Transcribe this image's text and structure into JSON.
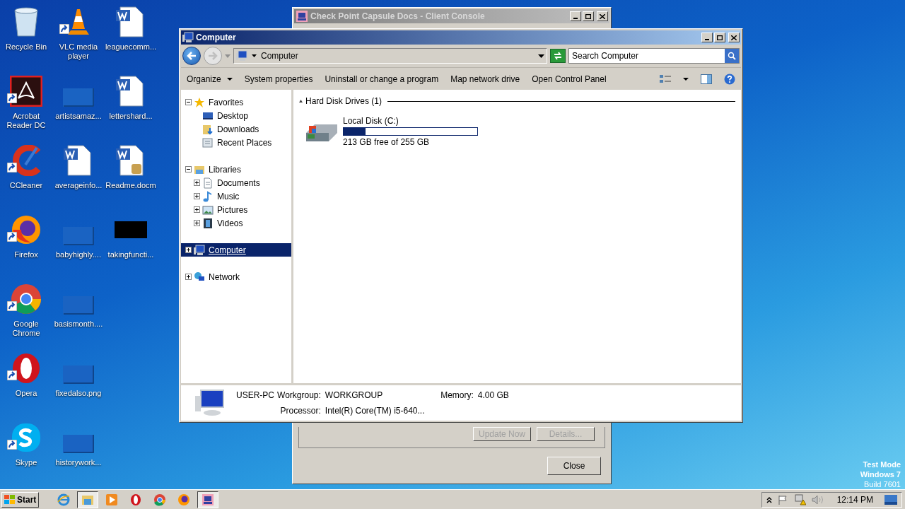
{
  "desktop_columns": [
    {
      "icons": [
        {
          "label": "Recycle Bin",
          "kind": "recycle"
        },
        {
          "label": "Acrobat Reader DC",
          "kind": "acrobat"
        },
        {
          "label": "CCleaner",
          "kind": "ccleaner"
        },
        {
          "label": "Firefox",
          "kind": "firefox"
        },
        {
          "label": "Google Chrome",
          "kind": "chrome"
        },
        {
          "label": "Opera",
          "kind": "opera"
        },
        {
          "label": "Skype",
          "kind": "skype"
        }
      ]
    },
    {
      "icons": [
        {
          "label": "VLC media player",
          "kind": "vlc"
        },
        {
          "label": "artistsamaz...",
          "kind": "blank"
        },
        {
          "label": "averageinfo...",
          "kind": "word"
        },
        {
          "label": "babyhighly....",
          "kind": "blank"
        },
        {
          "label": "basismonth....",
          "kind": "blank"
        },
        {
          "label": "fixedalso.png",
          "kind": "blank"
        },
        {
          "label": "historywork...",
          "kind": "blank"
        }
      ]
    },
    {
      "icons": [
        {
          "label": "leaguecomm...",
          "kind": "word"
        },
        {
          "label": "lettershard...",
          "kind": "word"
        },
        {
          "label": "Readme.docm",
          "kind": "word_macro"
        },
        {
          "label": "takingfuncti...",
          "kind": "black"
        }
      ]
    }
  ],
  "back_window": {
    "title": "Check Point Capsule Docs - Client Console",
    "buttons": [
      {
        "label": "Update Now",
        "disabled": true
      },
      {
        "label": "Details...",
        "disabled": true
      }
    ],
    "close_button": {
      "label": "Close",
      "disabled": false
    }
  },
  "window": {
    "title": "Computer",
    "address": "Computer",
    "search": {
      "placeholder": "Search Computer"
    },
    "commands": [
      {
        "label": "Organize",
        "dropdown": true
      },
      {
        "label": "System properties",
        "dropdown": false
      },
      {
        "label": "Uninstall or change a program",
        "dropdown": false
      },
      {
        "label": "Map network drive",
        "dropdown": false
      },
      {
        "label": "Open Control Panel",
        "dropdown": false
      }
    ],
    "nav": [
      {
        "label": "Favorites",
        "kind": "star",
        "expanded": true,
        "selected": false,
        "children": [
          {
            "label": "Desktop",
            "kind": "desktop",
            "selected": false
          },
          {
            "label": "Downloads",
            "kind": "downloads",
            "selected": false
          },
          {
            "label": "Recent Places",
            "kind": "recent",
            "selected": false
          }
        ]
      },
      {
        "label": "Libraries",
        "kind": "library",
        "expanded": true,
        "selected": false,
        "children": [
          {
            "label": "Documents",
            "kind": "documents",
            "expanded": false,
            "selected": false
          },
          {
            "label": "Music",
            "kind": "music",
            "expanded": false,
            "selected": false
          },
          {
            "label": "Pictures",
            "kind": "pictures",
            "expanded": false,
            "selected": false
          },
          {
            "label": "Videos",
            "kind": "videos",
            "expanded": false,
            "selected": false
          }
        ]
      },
      {
        "label": "Computer",
        "kind": "computer",
        "expanded": false,
        "selected": true
      },
      {
        "label": "Network",
        "kind": "network",
        "expanded": false,
        "selected": false
      }
    ],
    "group": {
      "title": "Hard Disk Drives (1)",
      "drives": [
        {
          "name": "Local Disk (C:)",
          "level": 0.165,
          "free": "213 GB free of 255 GB"
        }
      ]
    },
    "details": {
      "name": "USER-PC",
      "fields": [
        {
          "label": "Workgroup:",
          "value": "WORKGROUP"
        },
        {
          "label": "Memory:",
          "value": "4.00 GB"
        },
        {
          "label": "Processor:",
          "value": "Intel(R) Core(TM) i5-640..."
        }
      ]
    }
  },
  "watermark_text": [
    "Test Mode",
    "Windows 7",
    "Build 7601"
  ],
  "taskbar": {
    "start": "Start",
    "items": [
      {
        "kind": "ie",
        "active": false
      },
      {
        "kind": "explorer",
        "active": true
      },
      {
        "kind": "media",
        "active": false
      },
      {
        "kind": "opera",
        "active": false
      },
      {
        "kind": "chrome",
        "active": false
      },
      {
        "kind": "firefox",
        "active": false
      },
      {
        "kind": "console",
        "active": true
      }
    ],
    "clock": "12:14 PM"
  }
}
